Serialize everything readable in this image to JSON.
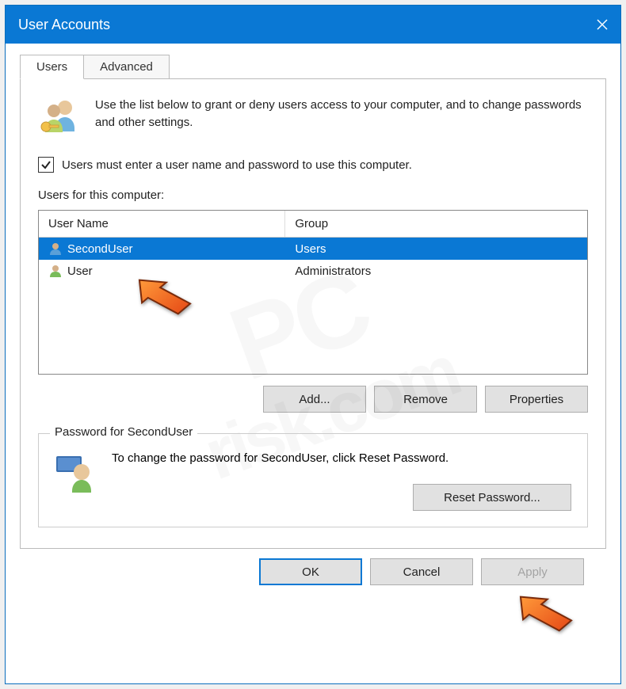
{
  "window": {
    "title": "User Accounts"
  },
  "tabs": [
    {
      "label": "Users"
    },
    {
      "label": "Advanced"
    }
  ],
  "intro": {
    "text": "Use the list below to grant or deny users access to your computer, and to change passwords and other settings."
  },
  "checkbox": {
    "label": "Users must enter a user name and password to use this computer.",
    "checked": true
  },
  "userlist": {
    "label": "Users for this computer:",
    "column_name": "User Name",
    "column_group": "Group",
    "users": [
      {
        "name": "SecondUser",
        "group": "Users"
      },
      {
        "name": "User",
        "group": "Administrators"
      }
    ]
  },
  "user_buttons": {
    "add": "Add...",
    "remove": "Remove",
    "properties": "Properties"
  },
  "password_box": {
    "title": "Password for SecondUser",
    "text": "To change the password for SecondUser, click Reset Password.",
    "button": "Reset Password..."
  },
  "dialog_buttons": {
    "ok": "OK",
    "cancel": "Cancel",
    "apply": "Apply"
  },
  "watermark": {
    "line1": "PC",
    "line2": "risk.com"
  }
}
